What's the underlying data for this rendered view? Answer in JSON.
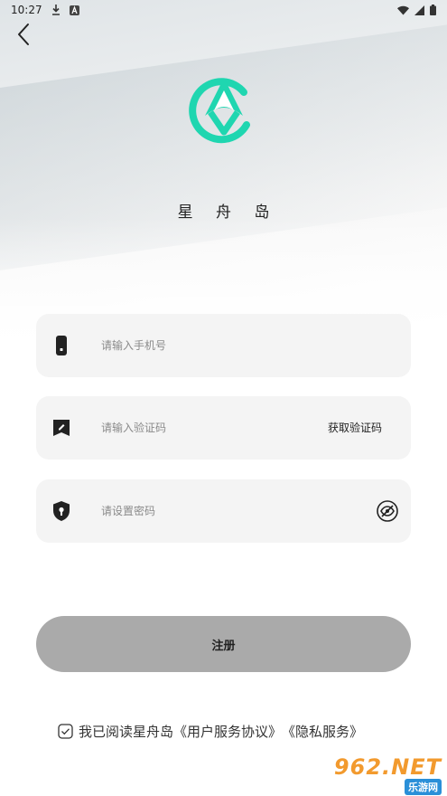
{
  "status_bar": {
    "time": "10:27",
    "icons_left": [
      "download-icon",
      "a-badge-icon"
    ],
    "icons_right": [
      "wifi-icon",
      "signal-icon",
      "battery-icon"
    ]
  },
  "app": {
    "name": "星 舟 岛",
    "logo_color": "#1fd6b0"
  },
  "form": {
    "phone_placeholder": "请输入手机号",
    "code_placeholder": "请输入验证码",
    "get_code_label": "获取验证码",
    "password_placeholder": "请设置密码"
  },
  "register": {
    "label": "注册",
    "bg_color": "#aaaaaa"
  },
  "agreement": {
    "prefix": "我已阅读星舟岛",
    "user_service": "《用户服务协议》",
    "privacy": "《隐私服务》"
  },
  "watermark": {
    "top": "962.NET",
    "bottom": "乐游网"
  }
}
